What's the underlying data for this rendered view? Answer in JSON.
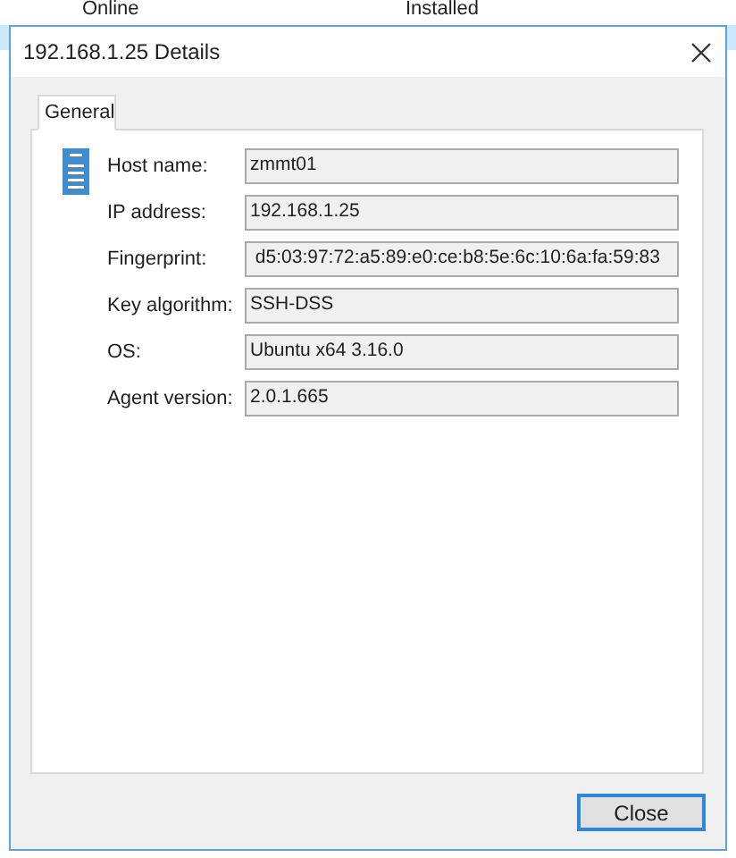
{
  "background_list": {
    "rows": [
      {
        "status": "Online",
        "agent": "Installed",
        "selected": false
      },
      {
        "selected": true
      }
    ]
  },
  "dialog": {
    "title": "192.168.1.25 Details",
    "tabs": [
      {
        "label": "General",
        "selected": true
      }
    ],
    "fields": [
      {
        "label": "Host name:",
        "value": "zmmt01"
      },
      {
        "label": "IP address:",
        "value": "192.168.1.25"
      },
      {
        "label": "Fingerprint:",
        "value": " d5:03:97:72:a5:89:e0:ce:b8:5e:6c:10:6a:fa:59:83"
      },
      {
        "label": "Key algorithm:",
        "value": "SSH-DSS"
      },
      {
        "label": "OS:",
        "value": "Ubuntu x64 3.16.0"
      },
      {
        "label": "Agent version:",
        "value": "2.0.1.665"
      }
    ],
    "buttons": [
      "Close"
    ]
  }
}
